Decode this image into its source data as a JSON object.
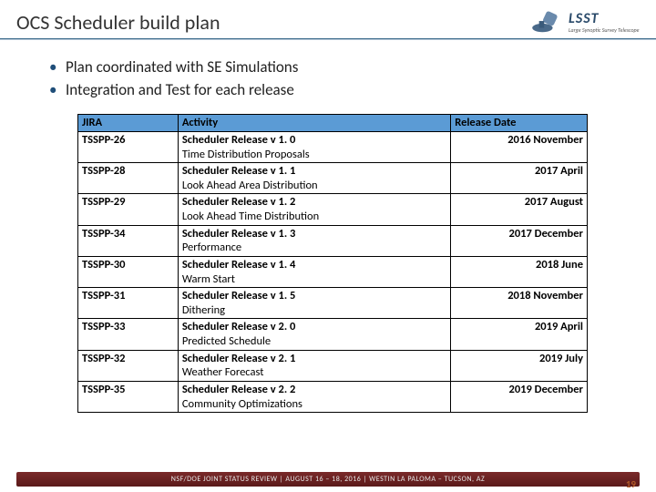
{
  "title": "OCS Scheduler build plan",
  "logo": {
    "big": "LSST",
    "sub": "Large Synoptic Survey Telescope"
  },
  "bullets": [
    "Plan coordinated with SE Simulations",
    "Integration and Test for each release"
  ],
  "table": {
    "headers": {
      "jira": "JIRA",
      "activity": "Activity",
      "date": "Release Date"
    },
    "rows": [
      {
        "jira": "TSSPP-26",
        "main": "Scheduler Release v 1. 0",
        "sub": "Time Distribution Proposals",
        "date": "2016 November"
      },
      {
        "jira": "TSSPP-28",
        "main": "Scheduler Release v 1. 1",
        "sub": "Look Ahead Area Distribution",
        "date": "2017 April"
      },
      {
        "jira": "TSSPP-29",
        "main": "Scheduler Release v 1. 2",
        "sub": "Look Ahead Time Distribution",
        "date": "2017 August"
      },
      {
        "jira": "TSSPP-34",
        "main": "Scheduler Release v 1. 3",
        "sub": "Performance",
        "date": "2017 December"
      },
      {
        "jira": "TSSPP-30",
        "main": "Scheduler Release v 1. 4",
        "sub": "Warm Start",
        "date": "2018 June"
      },
      {
        "jira": "TSSPP-31",
        "main": "Scheduler Release v 1. 5",
        "sub": "Dithering",
        "date": "2018 November"
      },
      {
        "jira": "TSSPP-33",
        "main": "Scheduler Release v 2. 0",
        "sub": "Predicted Schedule",
        "date": "2019 April"
      },
      {
        "jira": "TSSPP-32",
        "main": "Scheduler Release v 2. 1",
        "sub": "Weather Forecast",
        "date": "2019 July"
      },
      {
        "jira": "TSSPP-35",
        "main": "Scheduler Release v 2. 2",
        "sub": "Community Optimizations",
        "date": "2019 December"
      }
    ]
  },
  "footer": "NSF/DOE JOINT STATUS REVIEW  |  AUGUST 16 – 18, 2016  |  WESTIN LA PALOMA – TUCSON, AZ",
  "page": "19"
}
